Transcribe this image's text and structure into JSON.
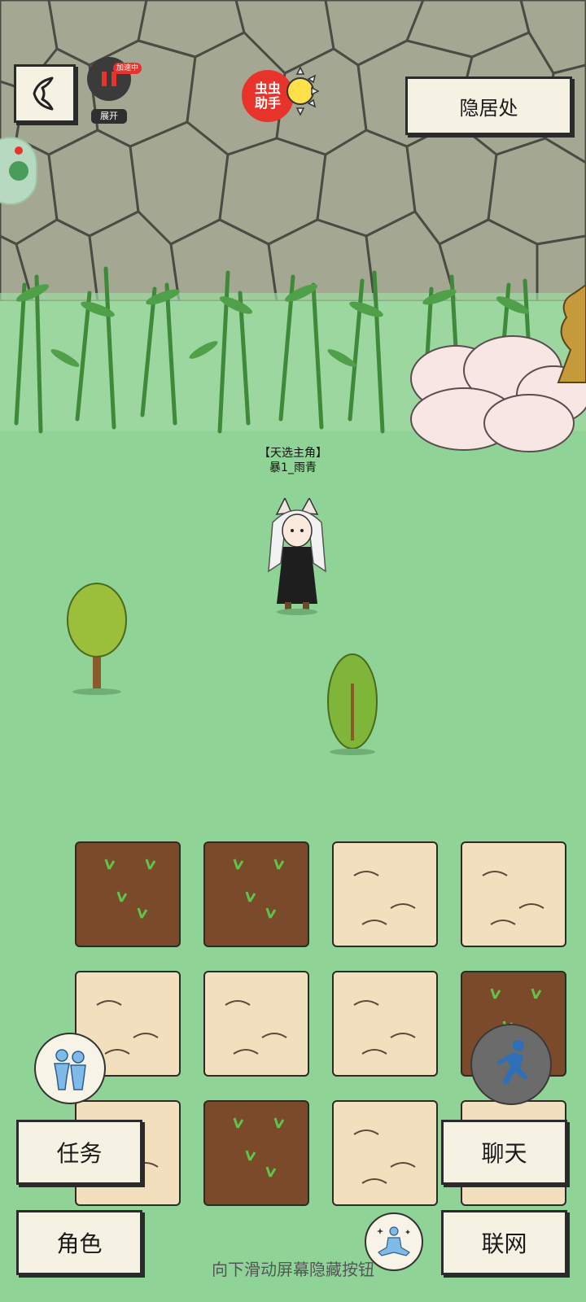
{
  "top_bar": {
    "location_title": "隐居处",
    "speed_badge": "加速中",
    "expand_label": "展开",
    "assistant_label_line1": "虫虫",
    "assistant_label_line2": "助手"
  },
  "character": {
    "title": "【天选主角】",
    "name": "暴1_雨青"
  },
  "bottom_menu": {
    "task": "任务",
    "role": "角色",
    "chat": "聊天",
    "network": "联网"
  },
  "hint": "向下滑动屏幕隐藏按钮",
  "farm_plots": [
    [
      "soil",
      "soil",
      "sand",
      "sand"
    ],
    [
      "sand",
      "sand",
      "sand",
      "soil"
    ],
    [
      "sand",
      "soil",
      "sand",
      "sand"
    ]
  ],
  "colors": {
    "grass": "#8fd396",
    "wall": "#a9ad97",
    "soil": "#7a4a2a",
    "sand": "#f2dfbd",
    "assistant_red": "#e8332b"
  },
  "icons": {
    "back": "back-chevron-icon",
    "speed": "speed-boost-icon",
    "assistant": "assistant-sun-icon",
    "social": "two-people-icon",
    "run": "running-person-icon",
    "meditate": "meditation-icon"
  }
}
